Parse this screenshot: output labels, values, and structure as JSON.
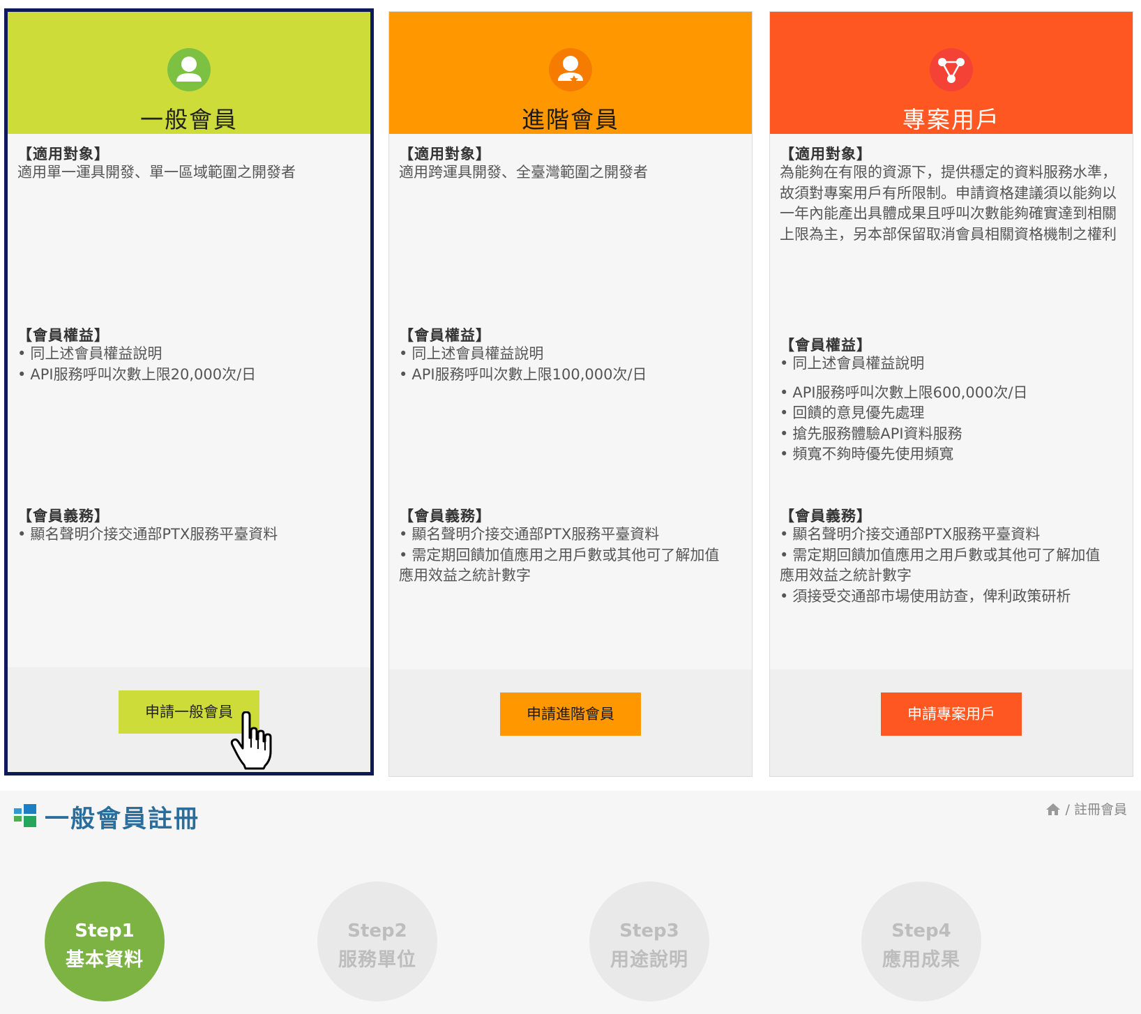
{
  "plans": [
    {
      "title": "一般會員",
      "target_heading": "【適用對象】",
      "target_text": "適用單一運具開發、單一區域範圍之開發者",
      "benefits_heading": "【會員權益】",
      "benefits": [
        "同上述會員權益說明",
        "API服務呼叫次數上限20,000次/日"
      ],
      "duties_heading": "【會員義務】",
      "duties": [
        "顯名聲明介接交通部PTX服務平臺資料"
      ],
      "button": "申請一般會員",
      "color": "#cddc39"
    },
    {
      "title": "進階會員",
      "target_heading": "【適用對象】",
      "target_text": "適用跨運具開發、全臺灣範圍之開發者",
      "benefits_heading": "【會員權益】",
      "benefits": [
        "同上述會員權益說明",
        "API服務呼叫次數上限100,000次/日"
      ],
      "duties_heading": "【會員義務】",
      "duties": [
        "顯名聲明介接交通部PTX服務平臺資料",
        "需定期回饋加值應用之用戶數或其他可了解加值",
        "應用效益之統計數字"
      ],
      "button": "申請進階會員",
      "color": "#ff9800"
    },
    {
      "title": "專案用戶",
      "target_heading": "【適用對象】",
      "target_text": "為能夠在有限的資源下，提供穩定的資料服務水準，故須對專案用戶有所限制。申請資格建議須以能夠以一年內能產出具體成果且呼叫次數能夠確實達到相關上限為主，另本部保留取消會員相關資格機制之權利",
      "benefits_heading": "【會員權益】",
      "benefits": [
        "同上述會員權益說明",
        "API服務呼叫次數上限600,000次/日",
        "回饋的意見優先處理",
        "搶先服務體驗API資料服務",
        "頻寬不夠時優先使用頻寬"
      ],
      "duties_heading": "【會員義務】",
      "duties": [
        "顯名聲明介接交通部PTX服務平臺資料",
        "需定期回饋加值應用之用戶數或其他可了解加值",
        "應用效益之統計數字",
        "須接受交通部市場使用訪查，俾利政策研析"
      ],
      "button": "申請專案用戶",
      "color": "#ff5722"
    }
  ],
  "registration": {
    "title": "一般會員註冊",
    "breadcrumb_sep": "/",
    "breadcrumb_current": "註冊會員",
    "steps": [
      {
        "num": "Step1",
        "label": "基本資料",
        "active": true
      },
      {
        "num": "Step2",
        "label": "服務單位",
        "active": false
      },
      {
        "num": "Step3",
        "label": "用途說明",
        "active": false
      },
      {
        "num": "Step4",
        "label": "應用成果",
        "active": false
      }
    ]
  },
  "icons": {
    "general_plan": "user-icon",
    "advanced_plan": "user-star-icon",
    "project_plan": "network-icon",
    "cursor": "hand-pointer-icon",
    "logo": "windows-logo-icon",
    "breadcrumb_home": "home-icon"
  },
  "colors": {
    "border_selected": "#0d1a55",
    "step_active": "#7cb342",
    "step_inactive": "#e9e9e9",
    "title_blue": "#2c6e9b"
  }
}
